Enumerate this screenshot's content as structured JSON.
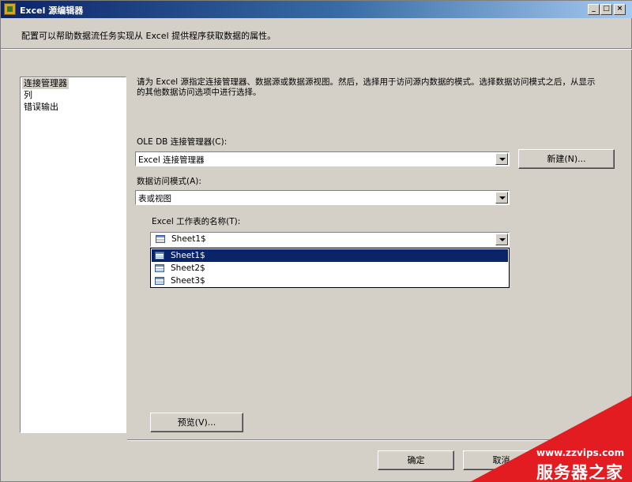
{
  "window": {
    "title": "Excel 源编辑器",
    "description": "配置可以帮助数据流任务实现从 Excel 提供程序获取数据的属性。",
    "controls": [
      "_",
      "□",
      "×"
    ]
  },
  "sidebar": {
    "items": [
      {
        "label": "连接管理器",
        "selected": true
      },
      {
        "label": "列",
        "selected": false
      },
      {
        "label": "错误输出",
        "selected": false
      }
    ]
  },
  "main": {
    "instruction": "请为 Excel 源指定连接管理器、数据源或数据源视图。然后，选择用于访问源内数据的模式。选择数据访问模式之后，从显示的其他数据访问选项中进行选择。",
    "connection_manager": {
      "label": "OLE DB 连接管理器(C):",
      "value": "Excel 连接管理器",
      "new_button": "新建(N)..."
    },
    "access_mode": {
      "label": "数据访问模式(A):",
      "value": "表或视图"
    },
    "sheet_name": {
      "label": "Excel 工作表的名称(T):",
      "value": "Sheet1$",
      "options": [
        "Sheet1$",
        "Sheet2$",
        "Sheet3$"
      ],
      "selected_index": 0
    },
    "preview_button": "预览(V)..."
  },
  "footer": {
    "ok_button": "确定",
    "cancel_button": "取消"
  },
  "watermark": {
    "url": "www.zzvips.com",
    "name": "服务器之家"
  },
  "colors": {
    "titlebar": "#0a246a",
    "selection": "#0a246a",
    "face": "#d4d0c8",
    "watermark": "#e31c22"
  }
}
